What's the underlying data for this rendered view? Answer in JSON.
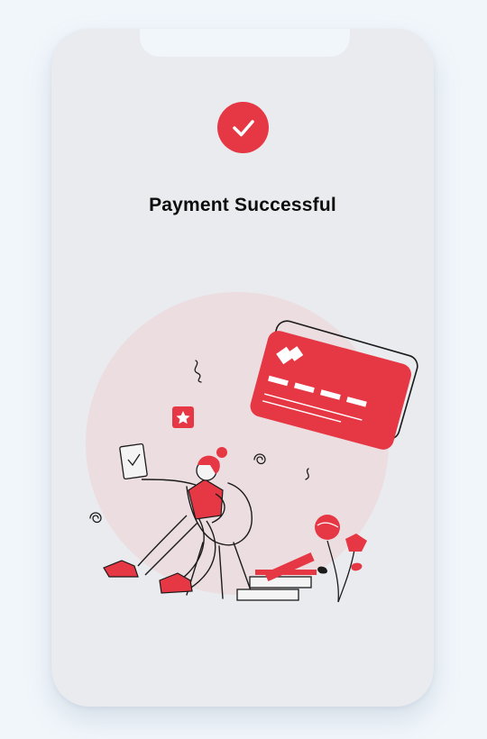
{
  "status": {
    "icon": "checkmark-icon",
    "title": "Payment Successful"
  },
  "illustration": {
    "name": "person-with-credit-card-illustration",
    "accent_color": "#e63744",
    "backdrop_color": "#ecdde0"
  }
}
